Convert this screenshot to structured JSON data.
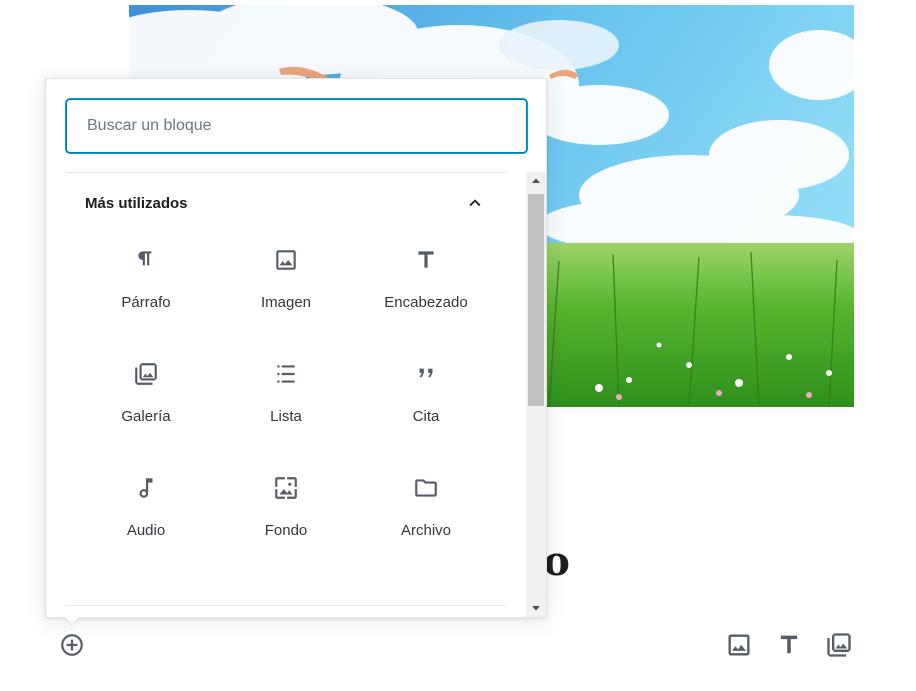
{
  "search": {
    "placeholder": "Buscar un bloque",
    "value": ""
  },
  "panel": {
    "title": "Más utilizados",
    "collapse_icon": "chevron-up-icon"
  },
  "blocks": [
    {
      "label": "Párrafo",
      "icon": "paragraph-icon"
    },
    {
      "label": "Imagen",
      "icon": "image-icon"
    },
    {
      "label": "Encabezado",
      "icon": "heading-icon"
    },
    {
      "label": "Galería",
      "icon": "gallery-icon"
    },
    {
      "label": "Lista",
      "icon": "list-icon"
    },
    {
      "label": "Cita",
      "icon": "quote-icon"
    },
    {
      "label": "Audio",
      "icon": "audio-icon"
    },
    {
      "label": "Fondo",
      "icon": "cover-icon"
    },
    {
      "label": "Archivo",
      "icon": "file-icon"
    }
  ],
  "editor": {
    "title_fragment": "ulo"
  },
  "bottom_toolbar": [
    "image-icon",
    "heading-icon",
    "gallery-icon"
  ],
  "inserter_toggle": "plus-circle-icon",
  "colors": {
    "accent": "#007cba",
    "icon": "#555d66",
    "text": "#1e1e1e"
  }
}
